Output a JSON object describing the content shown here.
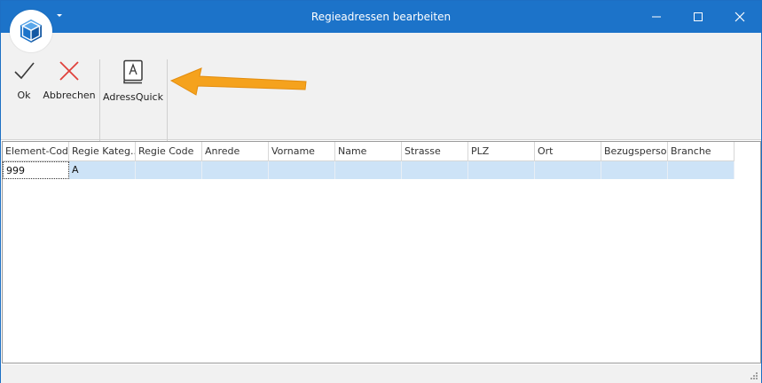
{
  "window": {
    "title": "Regieadressen bearbeiten",
    "accent_color": "#1c73c9"
  },
  "titlebar": {
    "app_icon": "cube-icon",
    "menu_icon": "chevron-down-icon",
    "minimize_icon": "minimize-icon",
    "maximize_icon": "maximize-icon",
    "close_icon": "close-icon"
  },
  "ribbon": {
    "ok_label": "Ok",
    "cancel_label": "Abbrechen",
    "adressquick_label": "AdressQuick",
    "ok_icon": "checkmark-icon",
    "cancel_icon": "x-icon",
    "adressquick_icon": "address-book-icon"
  },
  "annotation": {
    "arrow_icon": "orange-arrow-icon",
    "arrow_color": "#f5a21d"
  },
  "grid": {
    "columns": [
      "Element-Code",
      "Regie Kateg...",
      "Regie Code",
      "Anrede",
      "Vorname",
      "Name",
      "Strasse",
      "PLZ",
      "Ort",
      "Bezugsperson",
      "Branche"
    ],
    "rows": [
      [
        "999",
        "A",
        "",
        "",
        "",
        "",
        "",
        "",
        "",
        "",
        ""
      ]
    ],
    "selected_row_color": "#cde3f7"
  }
}
